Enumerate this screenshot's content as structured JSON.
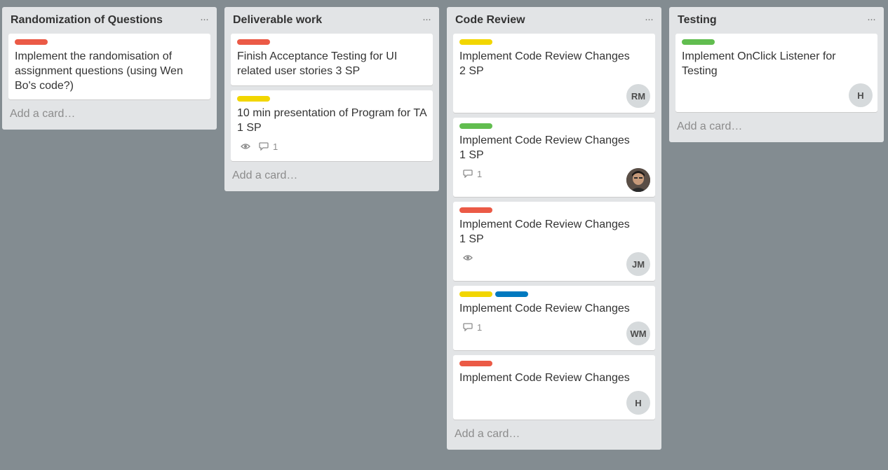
{
  "colors": {
    "board_bg": "#838c91",
    "list_bg": "#e2e4e6",
    "label_red": "#eb5a46",
    "label_yellow": "#f2d600",
    "label_green": "#61bd4f",
    "label_blue": "#0079bf"
  },
  "add_card_label": "Add a card…",
  "menu_label": "···",
  "lists": [
    {
      "title": "Randomization of Questions",
      "cards": [
        {
          "labels": [
            "red"
          ],
          "title": "Implement the randomisation of assignment questions (using Wen Bo's code?)"
        }
      ]
    },
    {
      "title": "Deliverable work",
      "cards": [
        {
          "labels": [
            "red"
          ],
          "title": "Finish Acceptance Testing for UI related user stories 3 SP"
        },
        {
          "labels": [
            "yellow"
          ],
          "title": "10 min presentation of Program for TA 1 SP",
          "badges": {
            "watch_icon": "eye-icon",
            "comment_icon": "comment-icon",
            "comments": "1"
          }
        }
      ]
    },
    {
      "title": "Code Review",
      "cards": [
        {
          "labels": [
            "yellow"
          ],
          "title": "Implement Code Review Changes 2 SP",
          "avatar": "RM"
        },
        {
          "labels": [
            "green"
          ],
          "title": "Implement Code Review Changes 1 SP",
          "badges": {
            "comment_icon": "comment-icon",
            "comments": "1"
          },
          "avatar_icon": "user-photo-avatar"
        },
        {
          "labels": [
            "red"
          ],
          "title": "Implement Code Review Changes 1 SP",
          "badges": {
            "watch_icon": "eye-icon"
          },
          "avatar": "JM"
        },
        {
          "labels": [
            "yellow",
            "blue"
          ],
          "title": "Implement Code Review Changes",
          "badges": {
            "comment_icon": "comment-icon",
            "comments": "1"
          },
          "avatar": "WM"
        },
        {
          "labels": [
            "red"
          ],
          "title": "Implement Code Review Changes",
          "avatar": "H"
        }
      ]
    },
    {
      "title": "Testing",
      "cards": [
        {
          "labels": [
            "green"
          ],
          "title": "Implement OnClick Listener for Testing",
          "avatar": "H"
        }
      ]
    }
  ]
}
